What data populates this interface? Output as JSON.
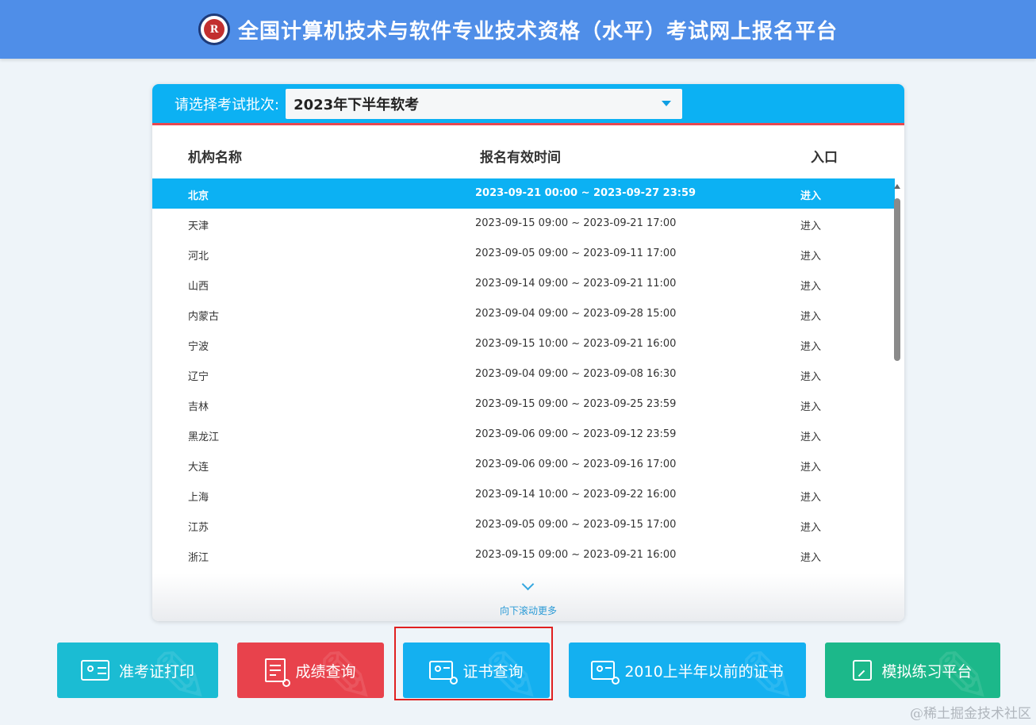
{
  "header": {
    "logo_letter": "R",
    "title": "全国计算机技术与软件专业技术资格（水平）考试网上报名平台"
  },
  "batch": {
    "label": "请选择考试批次:",
    "selected": "2023年下半年软考"
  },
  "table": {
    "columns": [
      "机构名称",
      "报名有效时间",
      "入口"
    ],
    "rows": [
      {
        "name": "北京",
        "time": "2023-09-21 00:00 ~ 2023-09-27 23:59",
        "entry": "进入",
        "active": true
      },
      {
        "name": "天津",
        "time": "2023-09-15 09:00 ~ 2023-09-21 17:00",
        "entry": "进入"
      },
      {
        "name": "河北",
        "time": "2023-09-05 09:00 ~ 2023-09-11 17:00",
        "entry": "进入"
      },
      {
        "name": "山西",
        "time": "2023-09-14 09:00 ~ 2023-09-21 11:00",
        "entry": "进入"
      },
      {
        "name": "内蒙古",
        "time": "2023-09-04 09:00 ~ 2023-09-28 15:00",
        "entry": "进入"
      },
      {
        "name": "宁波",
        "time": "2023-09-15 10:00 ~ 2023-09-21 16:00",
        "entry": "进入"
      },
      {
        "name": "辽宁",
        "time": "2023-09-04 09:00 ~ 2023-09-08 16:30",
        "entry": "进入"
      },
      {
        "name": "吉林",
        "time": "2023-09-15 09:00 ~ 2023-09-25 23:59",
        "entry": "进入"
      },
      {
        "name": "黑龙江",
        "time": "2023-09-06 09:00 ~ 2023-09-12 23:59",
        "entry": "进入"
      },
      {
        "name": "大连",
        "time": "2023-09-06 09:00 ~ 2023-09-16 17:00",
        "entry": "进入"
      },
      {
        "name": "上海",
        "time": "2023-09-14 10:00 ~ 2023-09-22 16:00",
        "entry": "进入"
      },
      {
        "name": "江苏",
        "time": "2023-09-05 09:00 ~ 2023-09-15 17:00",
        "entry": "进入"
      },
      {
        "name": "浙江",
        "time": "2023-09-15 09:00 ~ 2023-09-21 16:00",
        "entry": "进入"
      }
    ],
    "scroll_more": "向下滚动更多"
  },
  "buttons": {
    "admission": "准考证打印",
    "scores": "成绩查询",
    "certificate": "证书查询",
    "old_certificate": "2010上半年以前的证书",
    "practice": "模拟练习平台"
  },
  "icons": {
    "admission": "id-card-icon",
    "scores": "document-search-icon",
    "certificate": "certificate-search-icon",
    "old_certificate": "certificate-search-icon",
    "practice": "pen-note-icon"
  },
  "colors": {
    "header": "#4f8ee8",
    "accent": "#0cb1f3",
    "teal": "#1bbcd3",
    "red": "#e8424c",
    "green": "#1cb88a"
  },
  "watermark": "@稀土掘金技术社区"
}
